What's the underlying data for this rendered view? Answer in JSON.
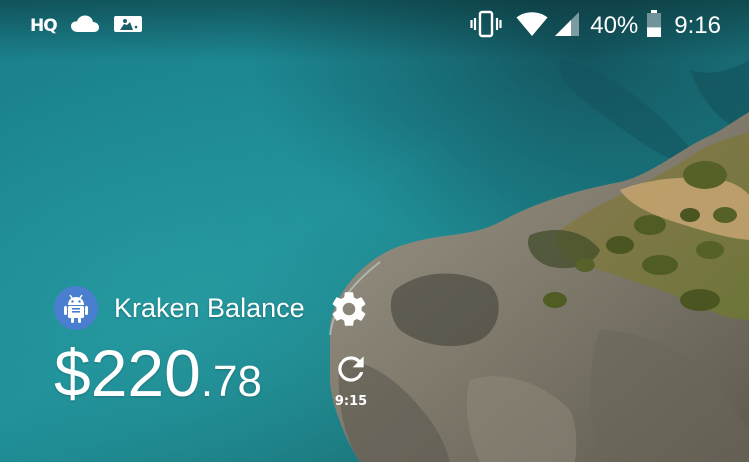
{
  "status_bar": {
    "left_icons": [
      "hq-trivia-icon",
      "cloud-icon",
      "mlb-icon"
    ],
    "hq_label": "HQ",
    "right_icons": [
      "vibrate-icon",
      "wifi-icon",
      "cell-signal-icon",
      "battery-icon"
    ],
    "battery_percent": "40%",
    "battery_level": 0.4,
    "time": "9:16"
  },
  "wallpaper": {
    "description_colors": {
      "sea": "#1e8a93",
      "deep_sea": "#15606a",
      "cliff": "#8a8476",
      "vegetation": "#4f5e2c",
      "sand": "#c49b6a"
    }
  },
  "widget": {
    "app_icon": "android-icon",
    "title": "Kraken Balance",
    "balance_main": "$220",
    "balance_cents": ".78",
    "settings_icon": "gear-icon",
    "refresh_icon": "refresh-icon",
    "refresh_time": "9:15"
  }
}
